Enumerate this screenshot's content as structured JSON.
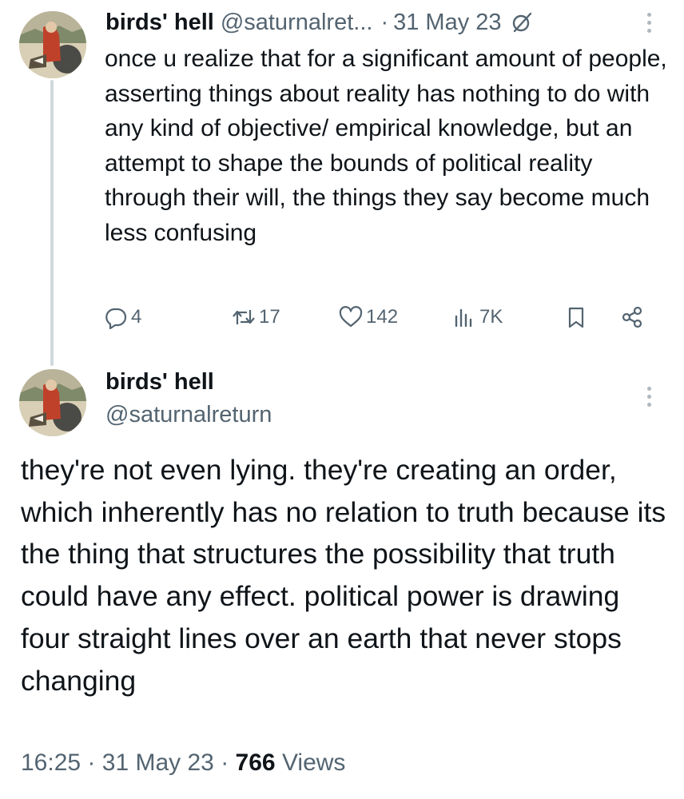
{
  "tweet1": {
    "author_name": "birds' hell",
    "handle": "@saturnalret...",
    "separator": "·",
    "date": "31 May 23",
    "text": "once u realize that for a significant amount of people, asserting things about reality has nothing to do with any kind of objective/ empirical knowledge, but an attempt to shape the bounds of political reality through their will, the things they say become much less confusing",
    "actions": {
      "replies": "4",
      "reposts": "17",
      "likes": "142",
      "views": "7K"
    },
    "icons": [
      "grok-icon",
      "more-icon",
      "reply-icon",
      "repost-icon",
      "like-icon",
      "views-icon",
      "bookmark-icon",
      "share-icon"
    ]
  },
  "tweet2": {
    "author_name": "birds' hell",
    "handle": "@saturnalreturn",
    "text": "they're not even lying. they're creating an order, which inherently has no relation to truth because its the thing that structures the possibility that truth could have any effect. political power is drawing four straight lines over an earth that never stops changing",
    "footer": {
      "time": "16:25",
      "sep1": "·",
      "date": "31 May 23",
      "sep2": "·",
      "views_count": "766",
      "views_label": "Views"
    }
  },
  "colors": {
    "text": "#0f1419",
    "secondary": "#536471",
    "thread_line": "#cfd9de",
    "dots": "#b0b8bf"
  }
}
